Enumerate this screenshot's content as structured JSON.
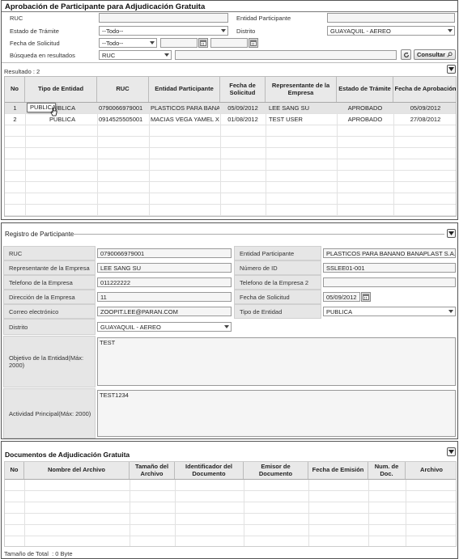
{
  "search_panel": {
    "title": "Aprobación de Participante para Adjudicación Gratuita",
    "labels": {
      "ruc": "RUC",
      "entidad": "Entidad Participante",
      "estado": "Estado de Trámite",
      "distrito": "Distrito",
      "fecha": "Fecha de Solicitud",
      "busqueda": "Búsqueda en resultados"
    },
    "values": {
      "ruc": "",
      "entidad": "",
      "estado": "--Todo--",
      "distrito": "GUAYAQUIL - AEREO",
      "fecha_tipo": "--Todo--",
      "fecha_desde": "",
      "fecha_hasta": "",
      "busqueda_campo": "RUC",
      "busqueda_texto": ""
    },
    "consultar_label": "Consultar",
    "result_label": "Resultado : 2",
    "table": {
      "headers": [
        "No",
        "Tipo de Entidad",
        "RUC",
        "Entidad Participante",
        "Fecha de Solicitud",
        "Representante de la Empresa",
        "Estado de Trámite",
        "Fecha de Aprobación"
      ],
      "rows": [
        [
          "1",
          "PUBLICA",
          "0790066979001",
          "PLASTICOS PARA BANAI",
          "05/09/2012",
          "LEE SANG SU",
          "APROBADO",
          "05/09/2012"
        ],
        [
          "2",
          "PUBLICA",
          "0914525505001",
          "MACIAS VEGA YAMEL XI",
          "01/08/2012",
          "TEST USER",
          "APROBADO",
          "27/08/2012"
        ]
      ],
      "tooltip": "PUBLICA"
    }
  },
  "registro_panel": {
    "title": "Registro de Participante",
    "fields": {
      "ruc_label": "RUC",
      "ruc": "0790066979001",
      "entidad_label": "Entidad Participante",
      "entidad": "PLASTICOS PARA BANANO BANAPLAST S.A.",
      "representante_label": "Representante de la Empresa",
      "representante": "LEE SANG SU",
      "numero_id_label": "Número de ID",
      "numero_id": "SSLEE01-001",
      "telefono_label": "Telefono de la Empresa",
      "telefono": "011222222",
      "telefono2_label": "Telefono de la Empresa 2",
      "telefono2": "",
      "direccion_label": "Dirección de la Empresa",
      "direccion": "11",
      "fecha_label": "Fecha de Solicitud",
      "fecha": "05/09/2012",
      "correo_label": "Correo electrónico",
      "correo": "ZOOPIT.LEE@PARAN.COM",
      "tipo_label": "Tipo de Entidad",
      "tipo": "PUBLICA",
      "distrito_label": "Distrito",
      "distrito": "GUAYAQUIL - AEREO",
      "objetivo_label": "Objetivo de la Entidad(Máx: 2000)",
      "objetivo": "TEST",
      "actividad_label": "Actividad Principal(Máx: 2000)",
      "actividad": "TEST1234"
    }
  },
  "documentos_panel": {
    "title": "Documentos de Adjudicación Gratuita",
    "headers": [
      "No",
      "Nombre del Archivo",
      "Tamaño del Archivo",
      "Identificador del Documento",
      "Emisor de Documento",
      "Fecha de Emisión",
      "Num. de Doc.",
      "Archivo"
    ],
    "total_label": "Tamaño de Total",
    "total_value": ": 0 Byte"
  }
}
